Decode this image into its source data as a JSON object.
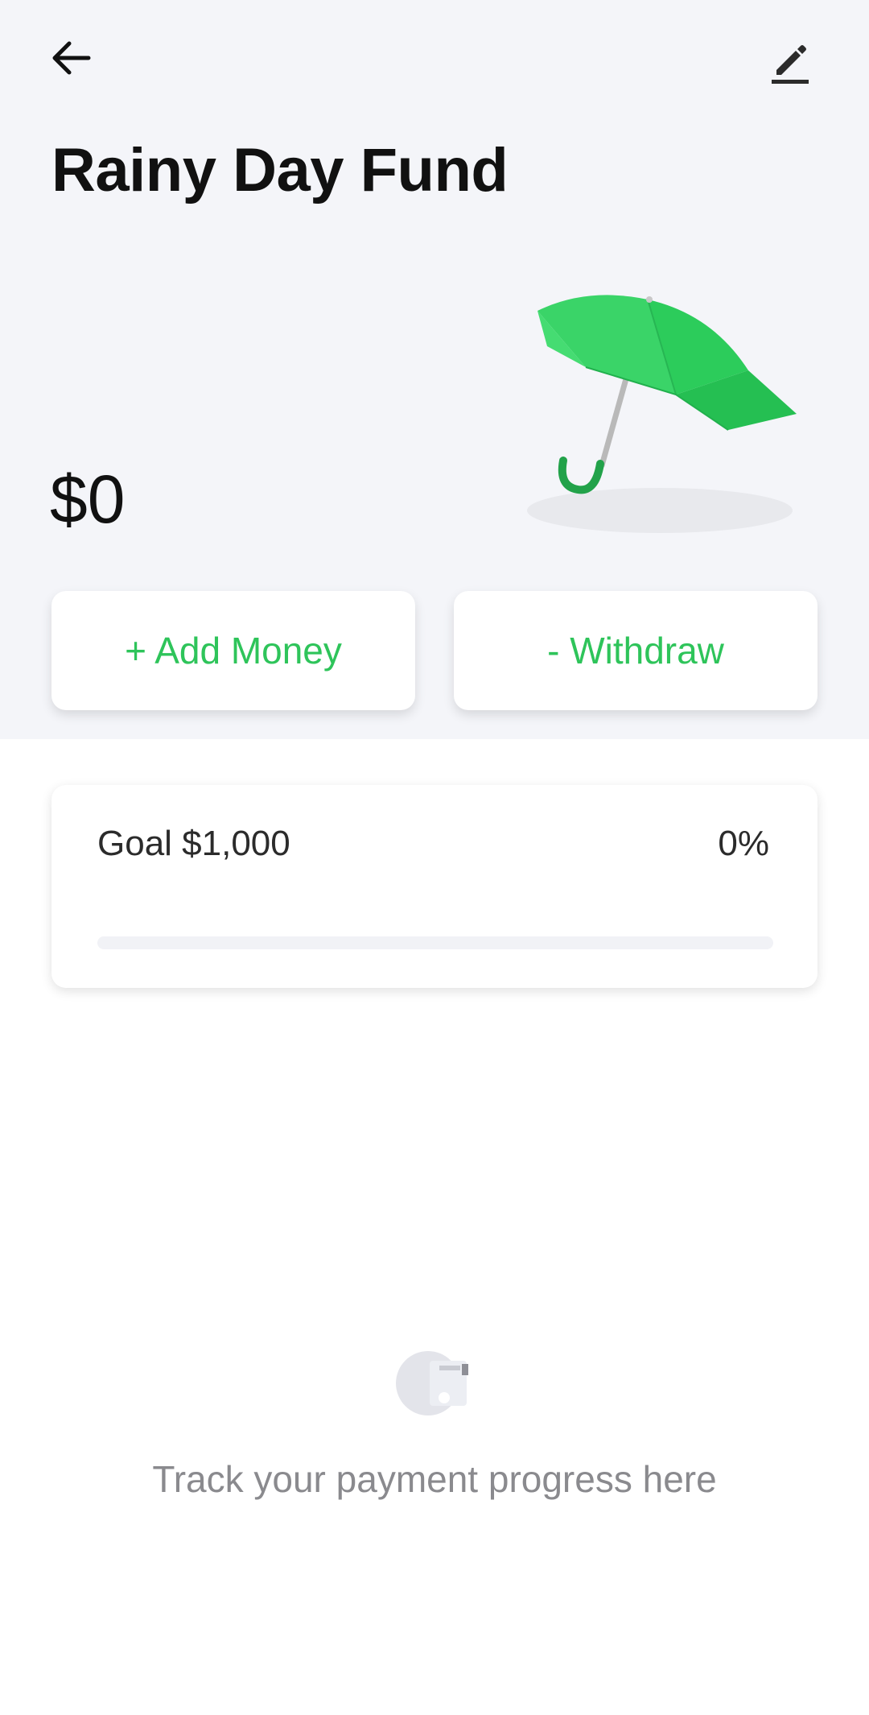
{
  "header": {
    "back_icon": "arrow-left-icon",
    "edit_icon": "pencil-icon",
    "title": "Rainy Day Fund"
  },
  "fund": {
    "balance": "$0",
    "illustration": "umbrella-icon",
    "add_money_label": "+ Add Money",
    "withdraw_label": "- Withdraw"
  },
  "goal": {
    "label": "Goal $1,000",
    "percent_text": "0%",
    "progress": 0
  },
  "empty_state": {
    "icon": "wallet-icon",
    "message": "Track your payment progress here"
  },
  "colors": {
    "accent": "#2ec45a",
    "hero_background": "#f4f5f9"
  }
}
